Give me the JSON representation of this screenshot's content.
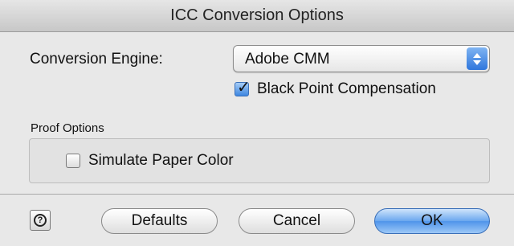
{
  "window": {
    "title": "ICC Conversion Options"
  },
  "engine": {
    "label": "Conversion Engine:",
    "selected": "Adobe CMM"
  },
  "black_point": {
    "label": "Black Point Compensation",
    "checked": true
  },
  "proof_options": {
    "legend": "Proof Options",
    "simulate_paper": {
      "label": "Simulate Paper Color",
      "checked": false
    }
  },
  "buttons": {
    "help_glyph": "?",
    "defaults": "Defaults",
    "cancel": "Cancel",
    "ok": "OK"
  },
  "icons": {
    "help": "help-icon",
    "popup": "up-down-arrows-icon",
    "check": "checkmark-icon"
  },
  "colors": {
    "accent": "#4f94ea",
    "background": "#e8e8e8"
  }
}
